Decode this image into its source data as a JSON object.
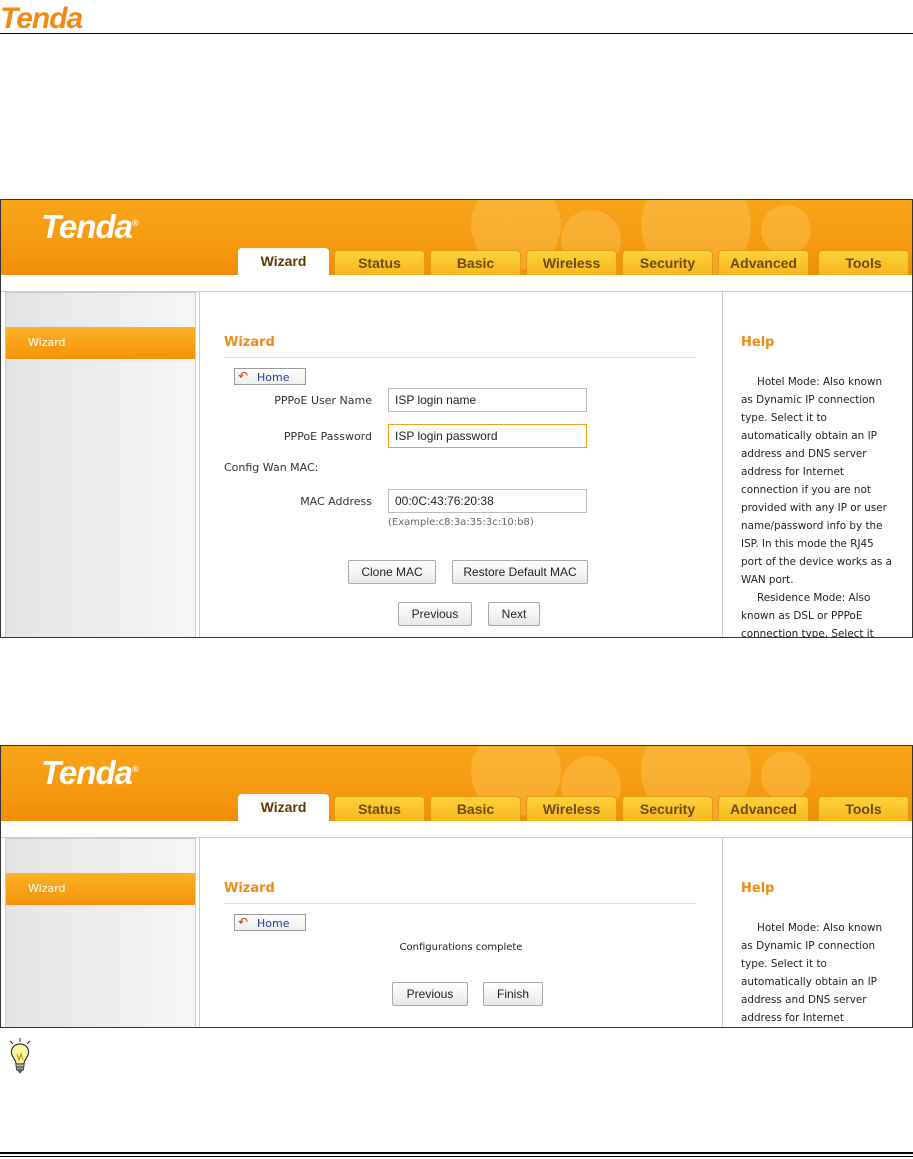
{
  "doc": {
    "logo": "Tenda"
  },
  "router": {
    "brand": "Tenda",
    "registered_mark": "®",
    "tabs": [
      "Wizard",
      "Status",
      "Basic",
      "Wireless",
      "Security",
      "Advanced",
      "Tools"
    ],
    "active_tab": "Wizard",
    "sidebar_item": "Wizard",
    "section_title": "Wizard",
    "home_label": "Home",
    "help_title": "Help"
  },
  "screen1": {
    "pppoe_user_label": "PPPoE User Name",
    "pppoe_user_value": "ISP login name",
    "pppoe_pass_label": "PPPoE Password",
    "pppoe_pass_value": "ISP login password",
    "config_wan_mac": "Config Wan MAC:",
    "mac_label": "MAC Address",
    "mac_value": "00:0C:43:76:20:38",
    "mac_example": "(Example:c8:3a:35:3c:10:b8)",
    "clone_mac": "Clone MAC",
    "restore_mac": "Restore Default MAC",
    "previous": "Previous",
    "next": "Next",
    "help_paragraphs": [
      "Hotel Mode: Also known as Dynamic IP connection type. Select it to automatically obtain an IP address and DNS server address for Internet connection if you are not provided with any IP or user name/password info by the ISP. In this mode the RJ45 port of the device works as a WAN port.",
      "Residence Mode: Also known as DSL or PPPoE connection type. Select it"
    ]
  },
  "screen2": {
    "complete_text": "Configurations complete",
    "previous": "Previous",
    "finish": "Finish",
    "help_paragraphs": [
      "Hotel Mode: Also known as Dynamic IP connection type. Select it to automatically obtain an IP address and DNS server address for Internet"
    ]
  },
  "colors": {
    "accent": "#f08a12",
    "header": "#f59a10"
  },
  "icons": {
    "tip": "lightbulb-icon",
    "home": "back-arrow-icon"
  }
}
